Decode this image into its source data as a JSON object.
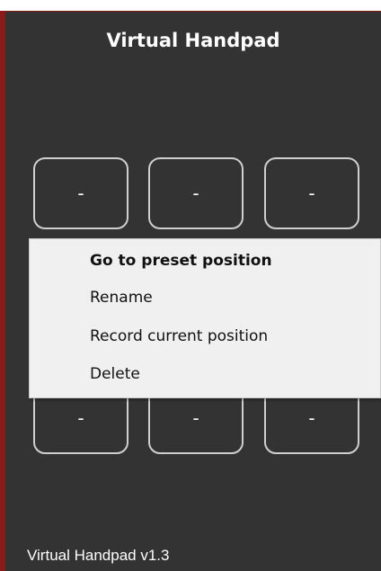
{
  "window": {
    "title": "Virtual Handpad",
    "footer": "Virtual Handpad v1.3"
  },
  "presets": {
    "top_row": [
      "-",
      "-",
      "-"
    ],
    "bottom_row": [
      "-",
      "-",
      "-"
    ]
  },
  "context_menu": {
    "items": [
      {
        "label": "Go to preset position",
        "default": true
      },
      {
        "label": "Rename"
      },
      {
        "label": "Record current position"
      },
      {
        "label": "Delete"
      }
    ]
  },
  "colors": {
    "background": "#333333",
    "border_accent": "#8b1a1a",
    "menu_background": "#f0f0f0"
  }
}
